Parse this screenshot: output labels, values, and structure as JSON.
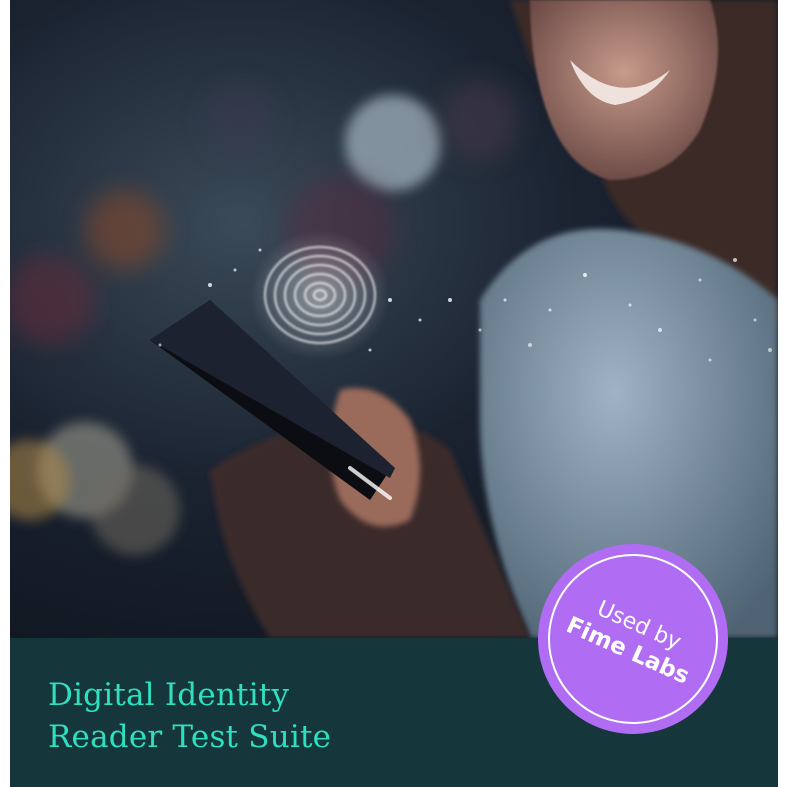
{
  "hero": {
    "image": "smiling-woman-with-smartphone-fingerprint-photo"
  },
  "footer": {
    "title_line1": "Digital Identity",
    "title_line2": "Reader Test Suite"
  },
  "badge": {
    "line1": "Used by",
    "line2": "Fime Labs"
  },
  "colors": {
    "footer_bg": "#15363a",
    "title_text": "#2ee0c0",
    "badge_bg": "#b06cf2",
    "badge_text": "#ffffff"
  }
}
